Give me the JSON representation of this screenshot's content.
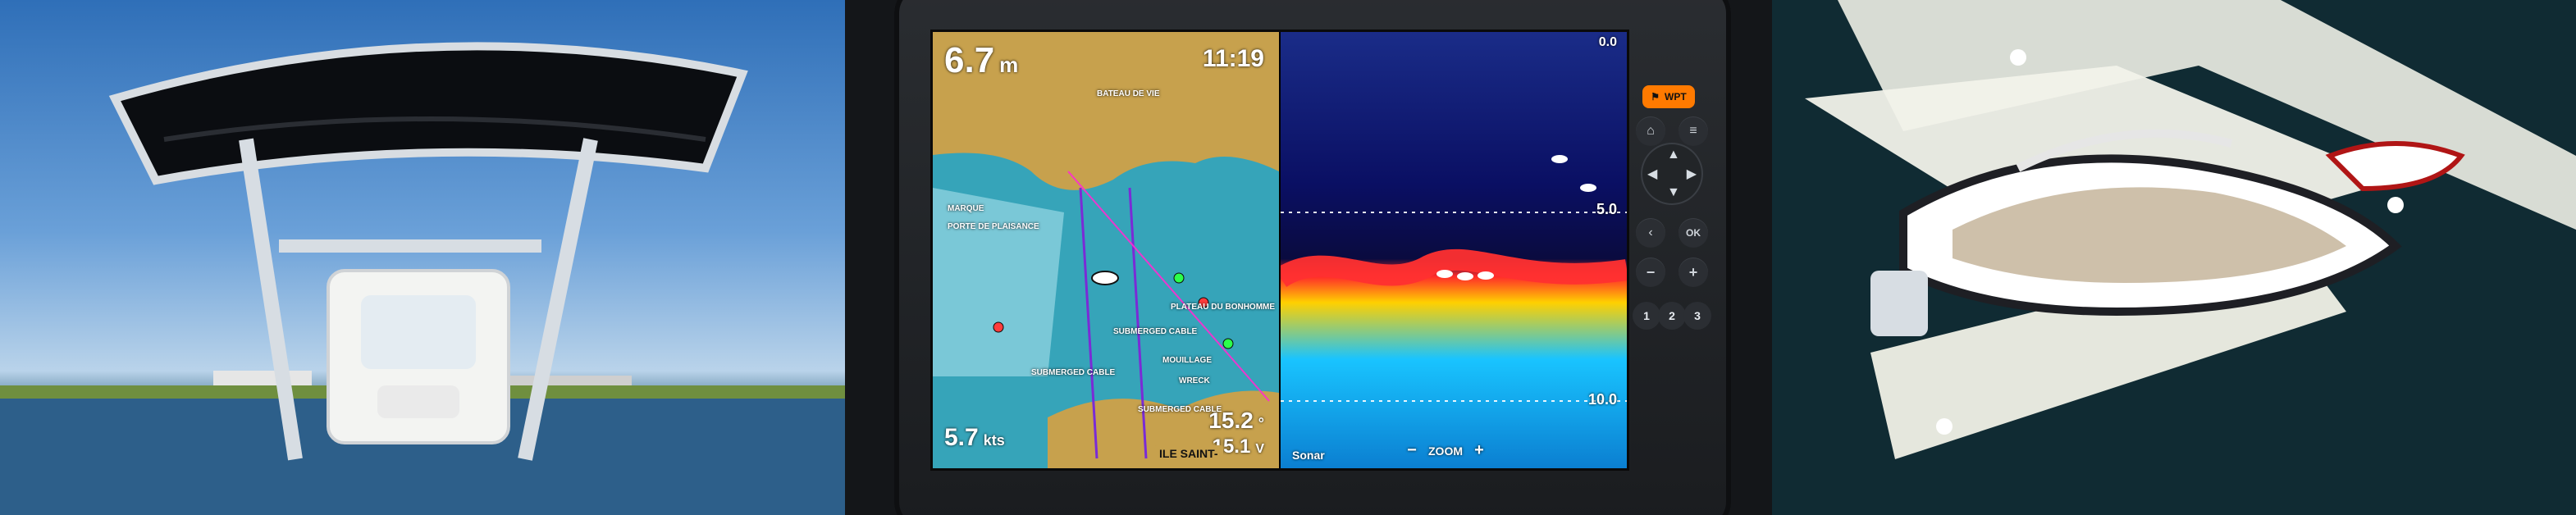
{
  "chart_panel": {
    "depth_value": "6.7",
    "depth_unit": "m",
    "time": "11:19",
    "speed_value": "5.7",
    "speed_unit": "kts",
    "heading_value": "15.2",
    "heading_unit": "°",
    "voltage_value": "15.1",
    "voltage_unit": "V",
    "place_name": "ILE SAINT-",
    "map_labels": [
      "BATEAU DE VIE",
      "SUBMERGED CABLE",
      "SUBMERGED CABLE",
      "MARQUE",
      "PORTE DE PLAISANCE",
      "MOUILLAGE",
      "PLATEAU DU BONHOMME",
      "WRECK",
      "SUBMERGED CABLE"
    ]
  },
  "sonar_panel": {
    "top_scale": "0.0",
    "scale_1": "5.0",
    "scale_2": "10.0",
    "zoom_label": "ZOOM",
    "zoom_minus": "−",
    "zoom_plus": "+",
    "mode_label": "Sonar"
  },
  "keypad": {
    "wpt_label": "WPT",
    "home_icon": "home-icon",
    "menu_icon": "menu-icon",
    "back_icon": "back-icon",
    "ok_label": "OK",
    "minus_label": "−",
    "plus_label": "+",
    "numbers": [
      "1",
      "2",
      "3"
    ]
  },
  "colors": {
    "accent_orange": "#ff7a00",
    "sea": "#2e7fa3",
    "land": "#c8a04a",
    "sonar_band": "#ff2b2b"
  }
}
